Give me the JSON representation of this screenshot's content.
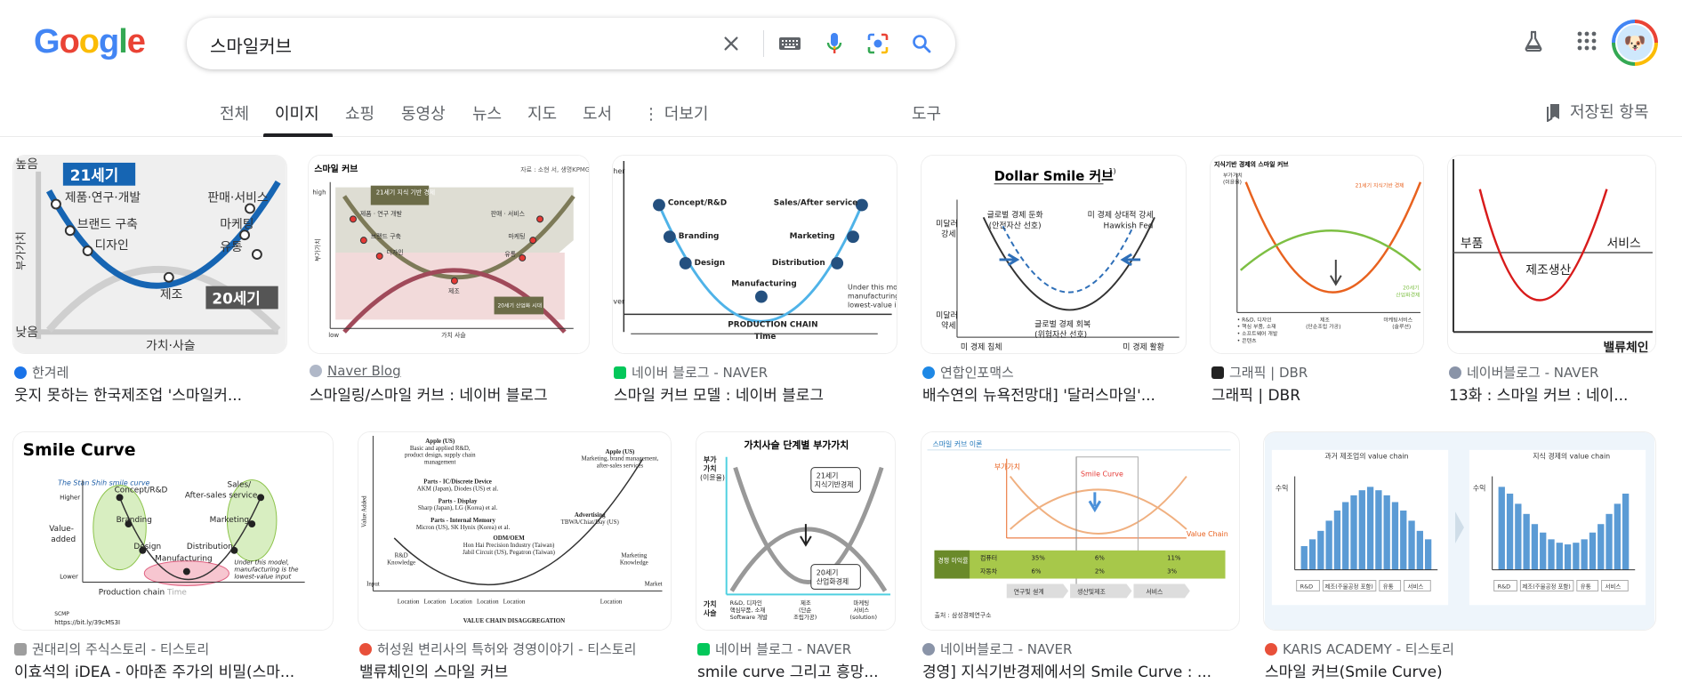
{
  "logo": {
    "text": "Google",
    "letters": [
      {
        "c": "G",
        "color": "#4285f4"
      },
      {
        "c": "o",
        "color": "#ea4335"
      },
      {
        "c": "o",
        "color": "#fbbc05"
      },
      {
        "c": "g",
        "color": "#4285f4"
      },
      {
        "c": "l",
        "color": "#34a853"
      },
      {
        "c": "e",
        "color": "#ea4335"
      }
    ]
  },
  "search": {
    "query": "스마일커브"
  },
  "icons": {
    "clear": "close-icon",
    "keyboard": "keyboard-icon",
    "voice": "mic-icon",
    "lens": "lens-icon",
    "search": "search-icon",
    "labs": "flask-icon",
    "apps": "apps-grid-icon",
    "saved": "bookmark-icon"
  },
  "tabs": [
    {
      "label": "전체"
    },
    {
      "label": "이미지",
      "active": true
    },
    {
      "label": "쇼핑"
    },
    {
      "label": "동영상"
    },
    {
      "label": "뉴스"
    },
    {
      "label": "지도"
    },
    {
      "label": "도서"
    },
    {
      "label": "⋮ 더보기"
    }
  ],
  "tools_label": "도구",
  "saved_label": "저장된 항목",
  "results": [
    {
      "source": "한겨레",
      "title": "웃지 못하는 한국제조업 '스마일커...",
      "favicon": "#1a73e8",
      "labels": {
        "highest": "높음",
        "lowest": "낮음",
        "ylabel": "부가가치",
        "xlabel": "가치·사슬",
        "c21": "21세기",
        "c20": "20세기",
        "a": "제품·연구·개발",
        "b": "브랜드 구축",
        "c": "디자인",
        "d": "판매·서비스",
        "e": "마케팅",
        "f": "유통",
        "m": "제조"
      }
    },
    {
      "source": "Naver Blog",
      "title": "스마일링/스마일 커브 : 네이버 블로그",
      "favicon": "#b0b8c8",
      "labels": {
        "head": "스마일 커브",
        "note": "자료 : 소현 서, 생명KPMG /",
        "hi": "high",
        "lo": "low",
        "y": "부가가치",
        "x": "가치 사슬",
        "a": "21세기 지식 기반 경제",
        "b": "20세기 산업화 시대",
        "p1": "제품 · 연구 개발",
        "p2": "브랜드 구축",
        "p3": "디자인",
        "p4": "판매 · 서비스",
        "p5": "마케팅",
        "p6": "유통",
        "m": "제조"
      }
    },
    {
      "source": "네이버 블로그 - NAVER",
      "title": "스마일 커브 모델 : 네이버 블로그",
      "favicon": "#03c75a",
      "labels": {
        "a": "Concept/R&D",
        "b": "Branding",
        "c": "Design",
        "d": "Manufacturing",
        "e": "Distribution",
        "f": "Marketing",
        "g": "Sales/After service",
        "chain": "PRODUCTION CHAIN",
        "time": "Time",
        "note1": "Under this mod",
        "note2": "manufacturing i",
        "note3": "lowest-value ing",
        "hi": "her",
        "lo": "ver"
      }
    },
    {
      "source": "연합인포맥스",
      "title": "배수연의 뉴욕전망대] '달러스마일'...",
      "favicon": "#1e88e5",
      "labels": {
        "title": "Dollar Smile 커브",
        "sup": "1)",
        "l1": "미달러",
        "l2": "강세",
        "l3": "미달러",
        "l4": "약세",
        "t1": "글로벌 경제 둔화",
        "t2": "(안전자산 선호)",
        "t3": "미 경제 상대적 강세",
        "t4": "Hawkish Fed",
        "t5": "글로벌 경제 회복",
        "t6": "(위험자산 선호)",
        "b1": "미 경제 침체",
        "b2": "미 경제 활황"
      }
    },
    {
      "source": "그래픽 | DBR",
      "title": "그래픽 | DBR",
      "favicon": "#222222",
      "labels": {
        "head": "지식기반 경제의 스마일 커브",
        "y1": "부가가치",
        "y2": "(이윤율)",
        "a": "21세기 지식기반 경제",
        "b": "20세기",
        "c": "산업화경제",
        "l1": "• R&D, 디자인",
        "l2": "• 핵심 부품, 소재",
        "l3": "• 소프트웨어 개발",
        "l4": "• 콘텐츠",
        "m1": "제조",
        "m2": "(단순조립 가공)",
        "r1": "마케팅서비스",
        "r2": "(솔루션)"
      }
    },
    {
      "source": "네이버블로그 - NAVER",
      "title": "13화 : 스마일 커브 : 네이...",
      "favicon": "#8a94a8",
      "labels": {
        "a": "부품",
        "b": "서비스",
        "c": "제조생산",
        "x": "밸류체인"
      }
    },
    {
      "source": "권대리의 주식스토리 - 티스토리",
      "title": "이효석의 iDEA - 아마존 주가의 비밀(스마...",
      "favicon": "#9e9e9e",
      "labels": {
        "title": "Smile Curve",
        "sub": "The Stan Shih smile curve",
        "hi": "Higher",
        "va1": "Value-",
        "va2": "added",
        "lo": "Lower",
        "a": "Concept/R&D",
        "b": "Branding",
        "c": "Design",
        "d": "Manufacturing",
        "e": "Distribution",
        "f": "Marketing",
        "g1": "Sales/",
        "g2": "After-sales service",
        "pc": "Production chain",
        "time": "Time",
        "n1": "Under this model,",
        "n2": "manufacturing is the",
        "n3": "lowest-value input",
        "src": "SCMP",
        "url": "https://bit.ly/39cMS3I"
      }
    },
    {
      "source": "허성원 변리사의 특허와 경영이야기 - 티스토리",
      "title": "밸류체인의 스마일 커브",
      "favicon": "#e8503a",
      "labels": {
        "y": "Value Added",
        "input": "Input",
        "market": "Market",
        "foot": "VALUE CHAIN DISAGGREGATION",
        "a1": "Apple (US)",
        "a2": "Basic and applied R&D,",
        "a3": "product design, supply chain",
        "a4": "management",
        "r1": "Apple (US)",
        "r2": "Marketing, brand management,",
        "r3": "after-sales services",
        "p1": "Parts - IC/Discrete Device",
        "p2": "AKM (Japan), Diodes (US) et al.",
        "p3": "Parts - Display",
        "p4": "Sharp (Japan), LG (Korea) et al.",
        "p5": "Parts - Internal Memory",
        "p6": "Micron (US), SK Hynix (Korea) et al.",
        "o1": "ODM/OEM",
        "o2": "Hon Hai Precision Industry (Taiwan)",
        "o3": "Jabil Circuit (US), Pegatron (Taiwan)",
        "ad1": "Advertising",
        "ad2": "TBWA/Chiat/Day (US)",
        "rd1": "R&D",
        "rd2": "Knowledge",
        "mk1": "Marketing",
        "mk2": "Knowledge",
        "loc": "Location"
      }
    },
    {
      "source": "네이버 블로그 - NAVER",
      "title": "smile curve 그리고 흥망...",
      "favicon": "#03c75a",
      "labels": {
        "title": "가치사슬 단계별 부가가치",
        "y1": "부가",
        "y2": "가치",
        "y3": "(이윤율)",
        "b1": "21세기",
        "b2": "지식기반경제",
        "c1": "20세기",
        "c2": "산업화경제",
        "x1": "가치",
        "x2": "사슬",
        "l1": "R&D, 디자인",
        "l2": "핵심부품, 소재",
        "l3": "Software 개발",
        "m1": "제조",
        "m2": "(단순",
        "m3": "조립가공)",
        "r1": "마케팅",
        "r2": "서비스",
        "r3": "(solution)"
      }
    },
    {
      "source": "네이버블로그 - NAVER",
      "title": "경영] 지식기반경제에서의 Smile Curve : ...",
      "favicon": "#8a94a8",
      "labels": {
        "head": "스마일 커브 이론",
        "y": "부가가치",
        "curve": "Smile Curve",
        "chain": "Value Chain",
        "row1": "경쟁 이익률",
        "k1": "컴퓨터",
        "k2": "자동차",
        "v1": "35%",
        "v2": "6%",
        "v3": "11%",
        "w1": "6%",
        "w2": "2%",
        "w3": "3%",
        "s1": "연구및 설계",
        "s2": "생산및제조",
        "s3": "서비스",
        "src": "출처 : 삼성경제연구소"
      }
    },
    {
      "source": "KARIS ACADEMY - 티스토리",
      "title": "스마일 커브(Smile Curve)",
      "favicon": "#e8503a",
      "labels": {
        "left": "과거 제조업의 value chain",
        "right": "지식 경제의 value chain",
        "y": "수익",
        "rd": "R&D",
        "mfg": "제조(주물공정 포함)",
        "dist": "유통",
        "svc": "서비스"
      },
      "bars_left": [
        0.28,
        0.36,
        0.46,
        0.58,
        0.7,
        0.8,
        0.88,
        0.94,
        0.98,
        0.94,
        0.88,
        0.8,
        0.7,
        0.58,
        0.46,
        0.36
      ],
      "bars_right": [
        0.98,
        0.9,
        0.78,
        0.66,
        0.54,
        0.44,
        0.36,
        0.32,
        0.3,
        0.32,
        0.36,
        0.44,
        0.54,
        0.66,
        0.78,
        0.9
      ]
    }
  ]
}
